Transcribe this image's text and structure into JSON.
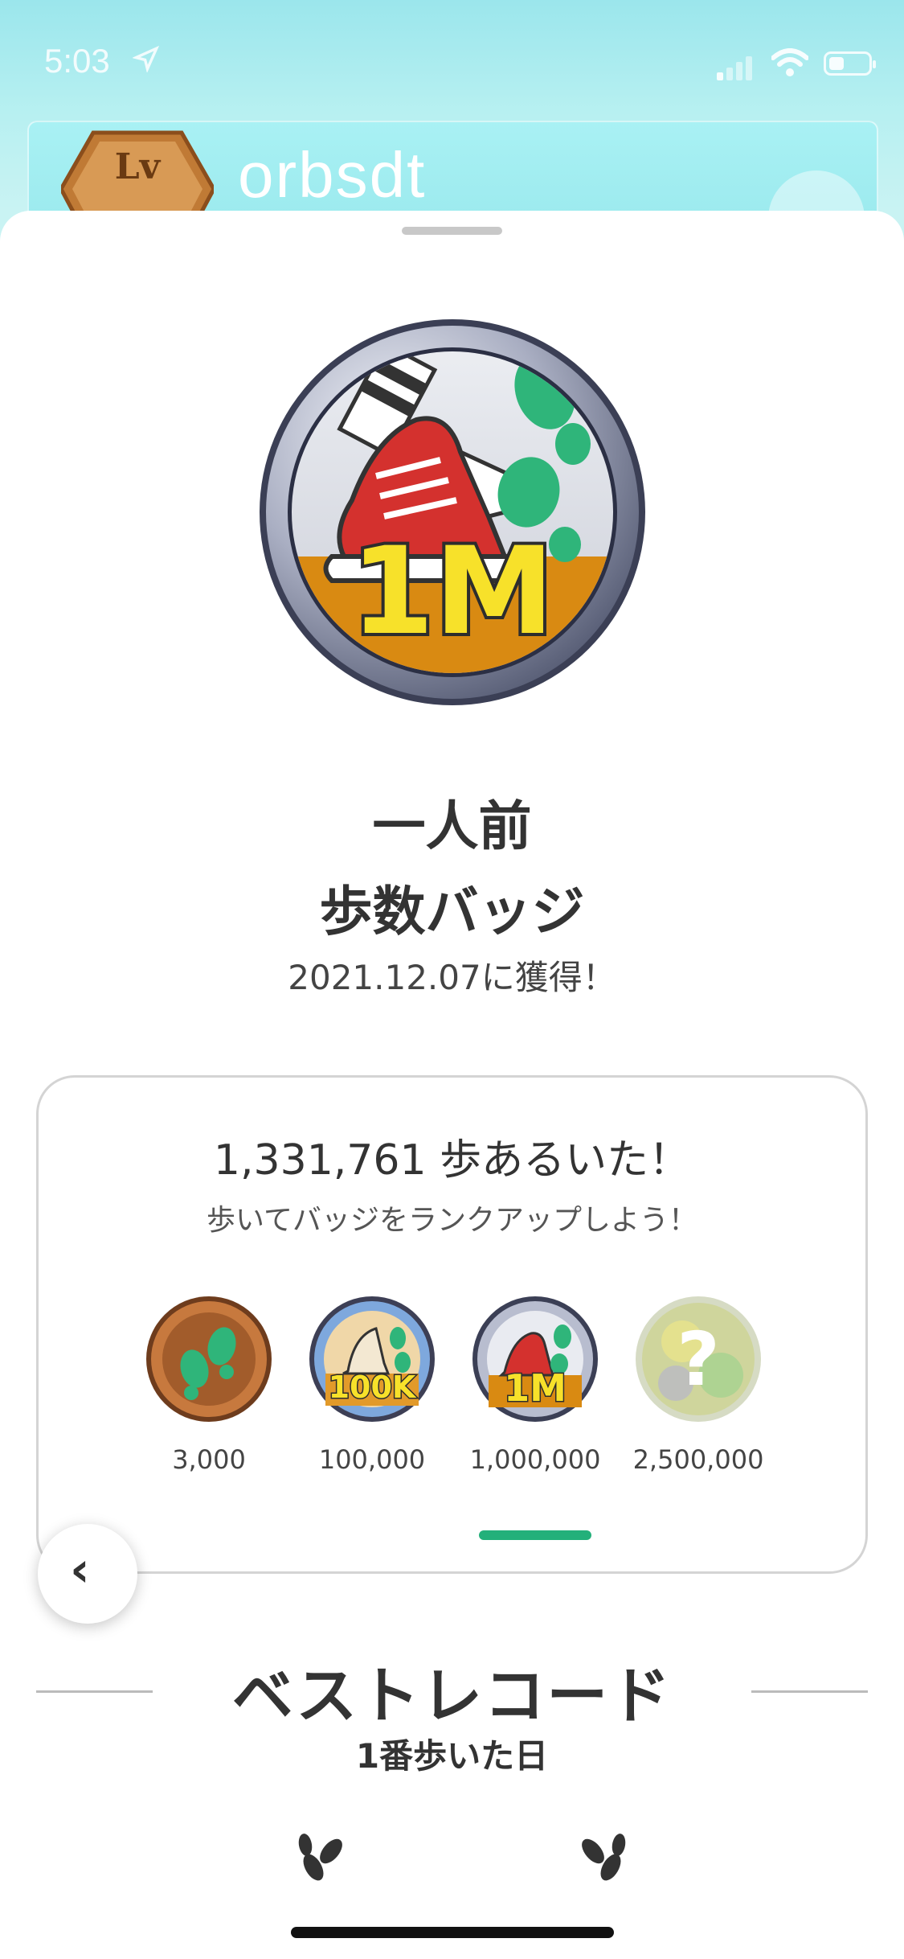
{
  "status_bar": {
    "time": "5:03"
  },
  "background_profile": {
    "level_label": "Lv",
    "username": "orbsdt"
  },
  "badge": {
    "title_line1": "一人前",
    "title_line2": "歩数バッジ",
    "earned_date": "2021.12.07に獲得！",
    "emblem_text": "1M"
  },
  "rank": {
    "steps_text": "1,331,761 歩あるいた！",
    "hint": "歩いてバッジをランクアップしよう！",
    "tiers": [
      {
        "label": "3,000",
        "icon": "bronze-footprints-badge"
      },
      {
        "label": "100,000",
        "icon": "100k-badge",
        "emblem_text": "100K"
      },
      {
        "label": "1,000,000",
        "icon": "1m-badge",
        "emblem_text": "1M"
      },
      {
        "label": "2,500,000",
        "icon": "locked-badge",
        "emblem_text": "?"
      }
    ],
    "selected_index": 2
  },
  "best_record": {
    "title": "ベストレコード",
    "subtitle": "1番歩いた日"
  },
  "colors": {
    "accent": "#23b07a",
    "badge_red": "#d4312e",
    "badge_yellow": "#f7e12a",
    "badge_ground": "#d98a12",
    "footprint_green": "#2fb57a"
  }
}
